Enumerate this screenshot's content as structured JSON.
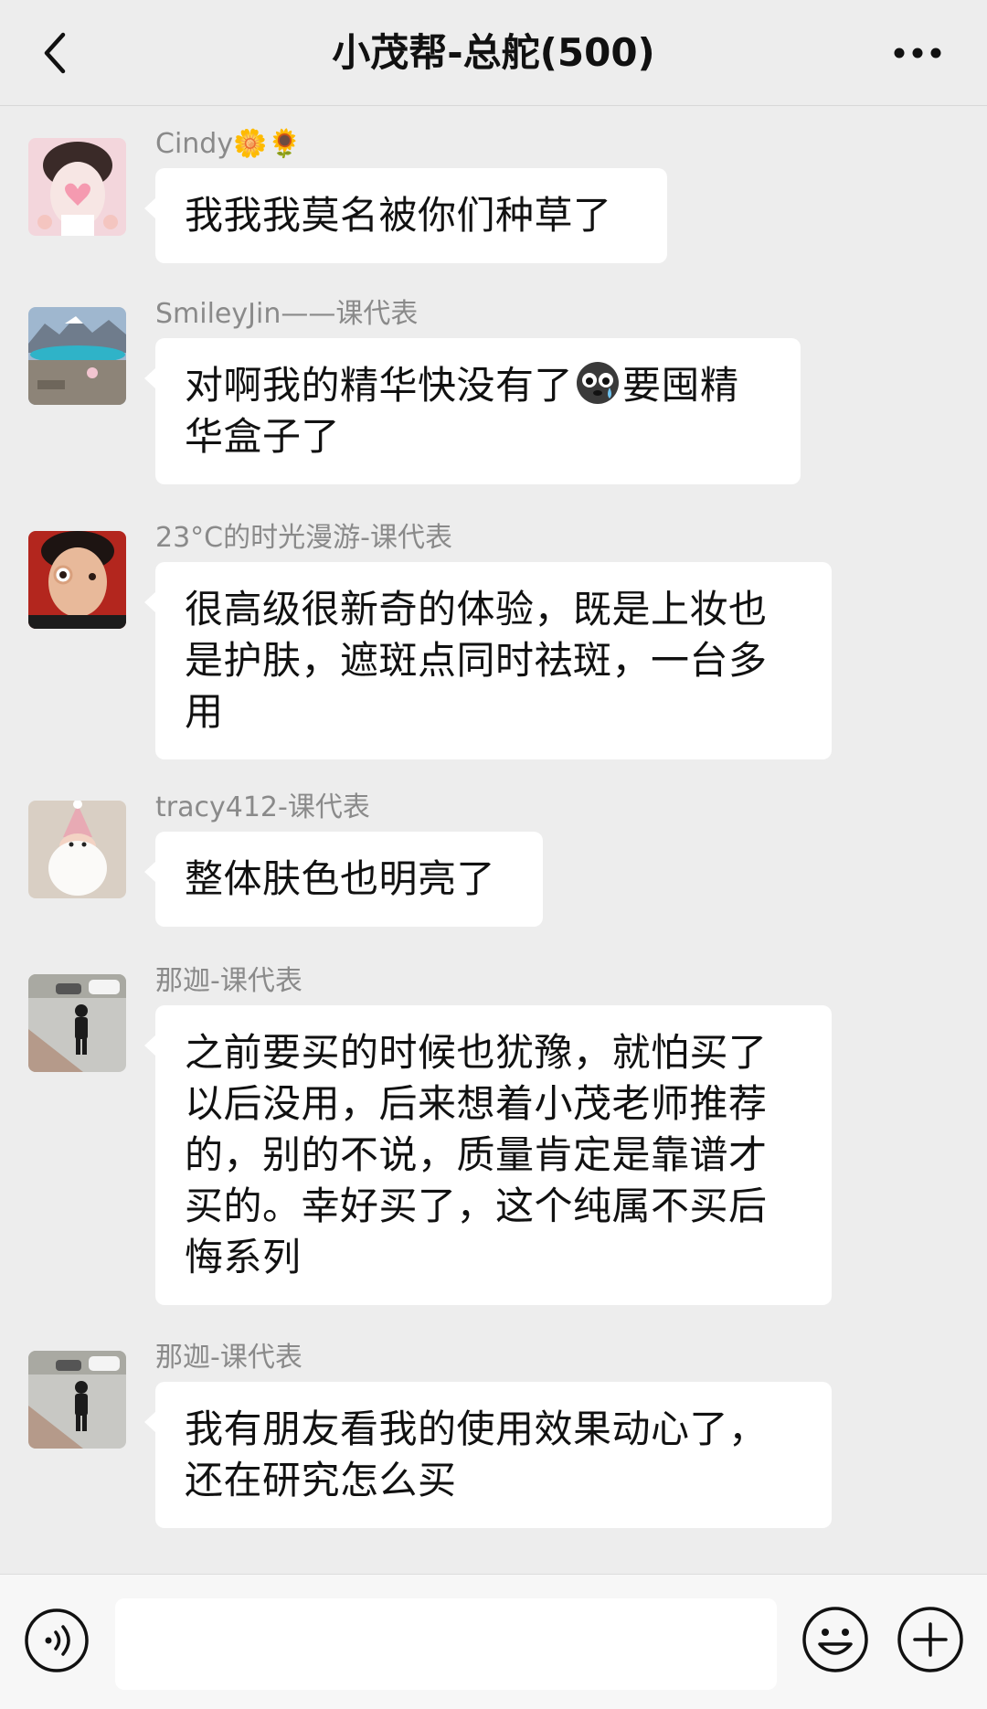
{
  "header": {
    "title": "小茂帮-总舵(500)",
    "back_icon": "chevron-left-icon",
    "more_icon": "more-dots-icon"
  },
  "messages": [
    {
      "sender": "Cindy🌼🌻",
      "text": "我我我莫名被你们种草了"
    },
    {
      "sender": "SmileyJin——课代表",
      "text_before": "对啊我的精华快没有了",
      "emoji": "crying-face-emoji",
      "text_after": "要囤精华盒子了"
    },
    {
      "sender": "23°C的时光漫游-课代表",
      "text": "很高级很新奇的体验，既是上妆也是护肤，遮斑点同时祛斑，一台多用"
    },
    {
      "sender": "tracy412-课代表",
      "text": "整体肤色也明亮了"
    },
    {
      "sender": "那迦-课代表",
      "text": "之前要买的时候也犹豫，就怕买了以后没用，后来想着小茂老师推荐的，别的不说，质量肯定是靠谱才买的。幸好买了，这个纯属不买后悔系列"
    },
    {
      "sender": "那迦-课代表",
      "text": "我有朋友看我的使用效果动心了，还在研究怎么买"
    }
  ],
  "bottom_bar": {
    "input_value": "",
    "voice_icon": "voice-icon",
    "emoji_icon": "emoji-icon",
    "plus_icon": "plus-icon"
  }
}
